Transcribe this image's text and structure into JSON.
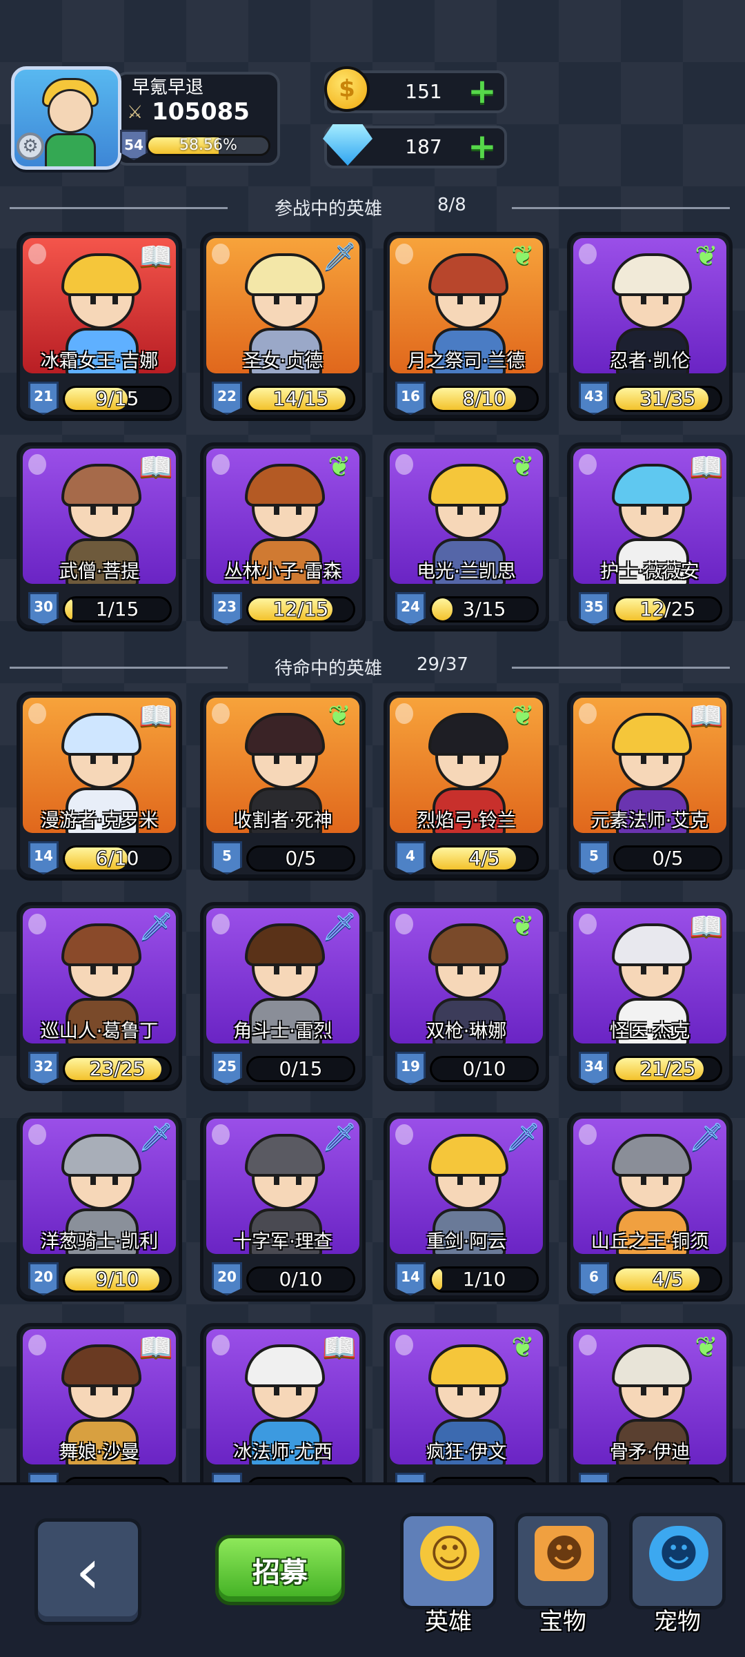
{
  "profile": {
    "name": "早氪早退",
    "power": "105085",
    "level": "54",
    "xp_percent": "58.56%",
    "xp_fraction": 0.5856
  },
  "currency": {
    "gold": "151",
    "gems": "187"
  },
  "sections": {
    "active": {
      "title": "参战中的英雄",
      "count": "8/8"
    },
    "standby": {
      "title": "待命中的英雄",
      "count": "29/37"
    }
  },
  "active_heroes": [
    {
      "name": "冰霜女王·吉娜",
      "level": "21",
      "progress": "9/15",
      "fill": 0.6,
      "rarity": "red",
      "tag": "book-icon",
      "hair": "#f5c63a",
      "outfit": "#5fb0ff"
    },
    {
      "name": "圣女·贞德",
      "level": "22",
      "progress": "14/15",
      "fill": 0.93,
      "rarity": "orange",
      "tag": "sword-icon",
      "hair": "#f3e7a8",
      "outfit": "#9aa8c8"
    },
    {
      "name": "月之祭司·兰德",
      "level": "16",
      "progress": "8/10",
      "fill": 0.8,
      "rarity": "orange",
      "tag": "wing-icon",
      "hair": "#b8462c",
      "outfit": "#4a7cc4"
    },
    {
      "name": "忍者·凯伦",
      "level": "43",
      "progress": "31/35",
      "fill": 0.89,
      "rarity": "purple",
      "tag": "wing-icon",
      "hair": "#f1ead8",
      "outfit": "#1c2030"
    },
    {
      "name": "武僧·菩提",
      "level": "30",
      "progress": "1/15",
      "fill": 0.07,
      "rarity": "purple",
      "tag": "book-icon",
      "hair": "#a66a4a",
      "outfit": "#6e5a3c"
    },
    {
      "name": "丛林小子·雷森",
      "level": "23",
      "progress": "12/15",
      "fill": 0.8,
      "rarity": "purple",
      "tag": "wing-icon",
      "hair": "#b45a24",
      "outfit": "#d07a32"
    },
    {
      "name": "电光·兰凯思",
      "level": "24",
      "progress": "3/15",
      "fill": 0.2,
      "rarity": "purple",
      "tag": "wing-icon",
      "hair": "#f5c63a",
      "outfit": "#5566a8"
    },
    {
      "name": "护士·薇薇安",
      "level": "35",
      "progress": "12/25",
      "fill": 0.48,
      "rarity": "purple",
      "tag": "book-icon",
      "hair": "#5fc8f0",
      "outfit": "#f0f0f0"
    }
  ],
  "standby_heroes": [
    {
      "name": "漫游者·克罗米",
      "level": "14",
      "progress": "6/10",
      "fill": 0.6,
      "rarity": "orange",
      "tag": "book-icon",
      "hair": "#cfe6ff",
      "outfit": "#e8eef8"
    },
    {
      "name": "收割者·死神",
      "level": "5",
      "progress": "0/5",
      "fill": 0,
      "rarity": "orange",
      "tag": "wing-icon",
      "hair": "#3a2326",
      "outfit": "#2a2a2e"
    },
    {
      "name": "烈焰弓·铃兰",
      "level": "4",
      "progress": "4/5",
      "fill": 0.8,
      "rarity": "orange",
      "tag": "wing-icon",
      "hair": "#1e1e24",
      "outfit": "#c8302c"
    },
    {
      "name": "元素法师·艾克",
      "level": "5",
      "progress": "0/5",
      "fill": 0,
      "rarity": "orange",
      "tag": "book-icon",
      "hair": "#f5c63a",
      "outfit": "#6a34b0"
    },
    {
      "name": "巡山人·葛鲁丁",
      "level": "32",
      "progress": "23/25",
      "fill": 0.92,
      "rarity": "purple",
      "tag": "sword-icon",
      "hair": "#8a4a2a",
      "outfit": "#7a4a2a"
    },
    {
      "name": "角斗士·雷烈",
      "level": "25",
      "progress": "0/15",
      "fill": 0,
      "rarity": "purple",
      "tag": "sword-icon",
      "hair": "#5a3218",
      "outfit": "#8a8e98"
    },
    {
      "name": "双枪·琳娜",
      "level": "19",
      "progress": "0/10",
      "fill": 0,
      "rarity": "purple",
      "tag": "wing-icon",
      "hair": "#7a4a2a",
      "outfit": "#3c3c5a"
    },
    {
      "name": "怪医·杰克",
      "level": "34",
      "progress": "21/25",
      "fill": 0.84,
      "rarity": "purple",
      "tag": "book-icon",
      "hair": "#e8e8ee",
      "outfit": "#f2f2f2"
    },
    {
      "name": "洋葱骑士·凯利",
      "level": "20",
      "progress": "9/10",
      "fill": 0.9,
      "rarity": "purple",
      "tag": "sword-icon",
      "hair": "#a8aeb8",
      "outfit": "#8a909a"
    },
    {
      "name": "十字军·理查",
      "level": "20",
      "progress": "0/10",
      "fill": 0,
      "rarity": "purple",
      "tag": "sword-icon",
      "hair": "#5a5a62",
      "outfit": "#4a4a52"
    },
    {
      "name": "重剑·阿云",
      "level": "14",
      "progress": "1/10",
      "fill": 0.1,
      "rarity": "purple",
      "tag": "sword-icon",
      "hair": "#f5c63a",
      "outfit": "#6a7a98"
    },
    {
      "name": "山丘之王·铜须",
      "level": "6",
      "progress": "4/5",
      "fill": 0.8,
      "rarity": "purple",
      "tag": "sword-icon",
      "hair": "#8a8e98",
      "outfit": "#f0a040"
    },
    {
      "name": "舞娘·沙曼",
      "level": "",
      "progress": "",
      "fill": 0,
      "rarity": "purple",
      "tag": "book-icon",
      "hair": "#6a3a22",
      "outfit": "#d8a040"
    },
    {
      "name": "冰法师·尤西",
      "level": "",
      "progress": "",
      "fill": 0,
      "rarity": "purple",
      "tag": "book-icon",
      "hair": "#f0f0f0",
      "outfit": "#3c9ae0"
    },
    {
      "name": "疯狂·伊文",
      "level": "",
      "progress": "",
      "fill": 0,
      "rarity": "purple",
      "tag": "wing-icon",
      "hair": "#f5c63a",
      "outfit": "#3c6ab0"
    },
    {
      "name": "骨矛·伊迪",
      "level": "",
      "progress": "",
      "fill": 0,
      "rarity": "purple",
      "tag": "wing-icon",
      "hair": "#e8e4d8",
      "outfit": "#5a4030"
    }
  ],
  "bottom_nav": {
    "recruit_label": "招募",
    "tabs": [
      {
        "label": "英雄",
        "icon": "hero-face-icon",
        "active": true
      },
      {
        "label": "宝物",
        "icon": "treasure-mask-icon",
        "active": false
      },
      {
        "label": "宠物",
        "icon": "pet-dragon-icon",
        "active": false
      }
    ]
  },
  "colors": {
    "background": "#232c3b",
    "progress_fill": "#f3c22c",
    "plus_green": "#56d84a",
    "recruit_green": "#3fae22"
  }
}
